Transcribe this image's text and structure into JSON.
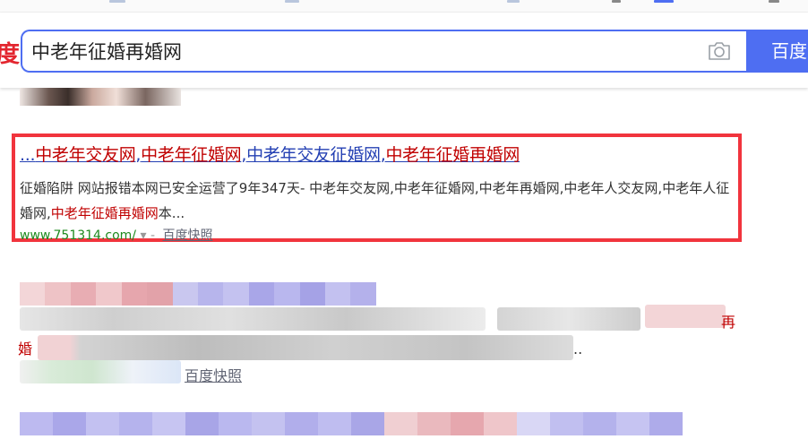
{
  "header": {
    "logo_fragment": "度",
    "search_query": "中老年征婚再婚网",
    "search_button": "百度"
  },
  "result": {
    "title_segments": [
      {
        "text": "...",
        "hl": false
      },
      {
        "text": "中老年交友网",
        "hl": true
      },
      {
        "text": ",",
        "hl": false
      },
      {
        "text": "中老年征婚网",
        "hl": true
      },
      {
        "text": ",",
        "hl": false
      },
      {
        "text": "中老年交友征婚网",
        "hl": false
      },
      {
        "text": ",",
        "hl": false
      },
      {
        "text": "中老年征婚再婚网",
        "hl": true
      }
    ],
    "abstract_pre": "征婚陷阱 网站报错本网已安全运营了9年347天- 中老年交友网,中老年征婚网,中老年再婚网,中老年人交友网,中老年人征婚网,",
    "abstract_hl": "中老年征婚再婚网",
    "abstract_post": "本...",
    "url": "www.751314.com/",
    "snapshot": "百度快照"
  },
  "blurred_result": {
    "snippet_right": "再",
    "snippet_left": "婚",
    "ellipsis": "..",
    "snapshot": "百度快照"
  },
  "colors": {
    "accent": "#4e6ef2",
    "highlight_box": "#f1343d",
    "keyword": "#c00000",
    "link": "#2440b3",
    "url": "#1e8a1e"
  }
}
